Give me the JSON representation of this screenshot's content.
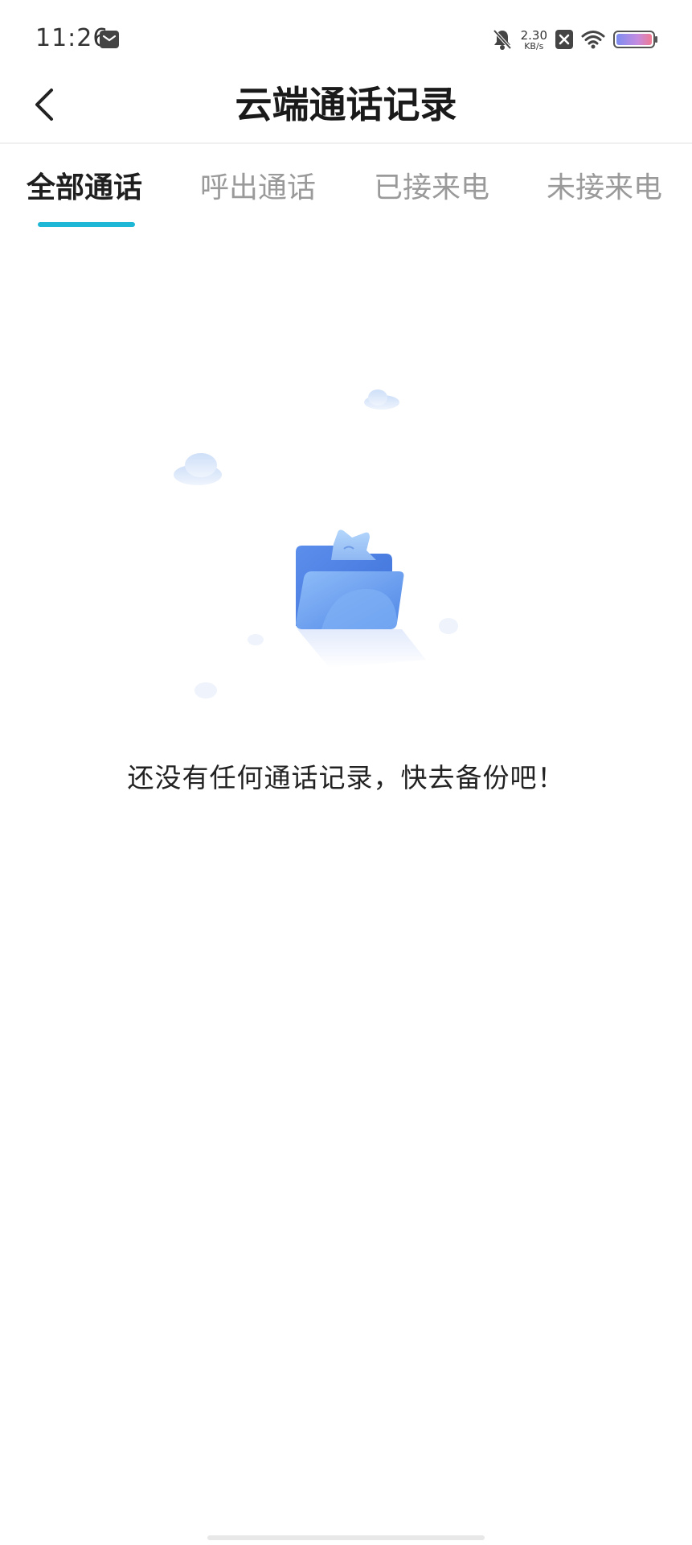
{
  "status_bar": {
    "time": "11:26",
    "net_speed_value": "2.30",
    "net_speed_unit": "KB/s",
    "icons": [
      "mail-icon",
      "mute-bell-icon",
      "close-box-icon",
      "wifi-icon",
      "battery-icon"
    ]
  },
  "header": {
    "title": "云端通话记录",
    "back_icon": "chevron-left-icon"
  },
  "tabs": [
    {
      "label": "全部通话",
      "active": true
    },
    {
      "label": "呼出通话",
      "active": false
    },
    {
      "label": "已接来电",
      "active": false
    },
    {
      "label": "未接来电",
      "active": false
    }
  ],
  "empty_state": {
    "illustration": "cloud-folder-illustration",
    "message": "还没有任何通话记录，快去备份吧！"
  },
  "colors": {
    "accent": "#1fb7d6",
    "tab_inactive": "#9a9a9a",
    "folder_blue": "#4f86e6"
  }
}
